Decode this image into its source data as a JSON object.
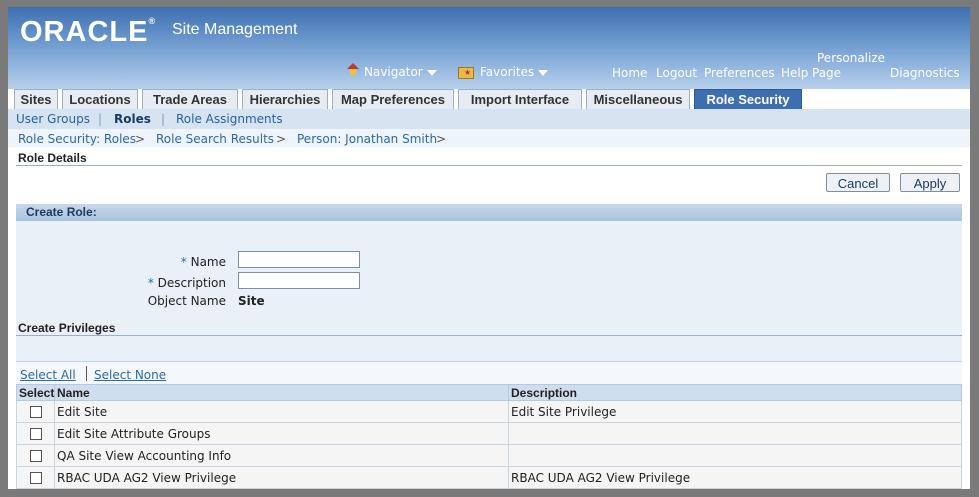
{
  "header": {
    "logo_text": "ORACLE",
    "logo_mark": "®",
    "app_title": "Site Management",
    "navigator_label": "Navigator",
    "favorites_label": "Favorites",
    "links": {
      "home": "Home",
      "logout": "Logout",
      "preferences": "Preferences",
      "help": "Help",
      "personalize_line1": "Personalize",
      "personalize_line2": "Page",
      "diagnostics": "Diagnostics"
    }
  },
  "tabs": [
    {
      "label": "Sites"
    },
    {
      "label": "Locations"
    },
    {
      "label": "Trade Areas"
    },
    {
      "label": "Hierarchies"
    },
    {
      "label": "Map Preferences"
    },
    {
      "label": "Import Interface"
    },
    {
      "label": "Miscellaneous"
    },
    {
      "label": "Role Security"
    }
  ],
  "subtabs": [
    {
      "label": "User Groups"
    },
    {
      "label": "Roles"
    },
    {
      "label": "Role Assignments"
    }
  ],
  "breadcrumb": [
    {
      "label": "Role Security: Roles"
    },
    {
      "label": "Role Search Results"
    },
    {
      "label": "Person: Jonathan Smith"
    }
  ],
  "breadcrumb_sep": ">",
  "page_title": "Role Details",
  "buttons": {
    "cancel": "Cancel",
    "apply": "Apply"
  },
  "create_role": {
    "header": "Create Role:",
    "required_mark": "*",
    "name_label": "Name",
    "name_value": "",
    "description_label": "Description",
    "description_value": "",
    "object_name_label": "Object Name",
    "object_name_value": "Site"
  },
  "privileges": {
    "header": "Create Privileges",
    "select_all": "Select All",
    "select_none": "Select None",
    "columns": {
      "select": "Select",
      "name": "Name",
      "description": "Description"
    },
    "rows": [
      {
        "name": "Edit Site",
        "description": "Edit Site Privilege",
        "checked": false
      },
      {
        "name": "Edit Site Attribute Groups",
        "description": "",
        "checked": false
      },
      {
        "name": "QA Site View Accounting Info",
        "description": "",
        "checked": false
      },
      {
        "name": "RBAC UDA AG2 View Privilege",
        "description": "RBAC UDA AG2 View Privilege",
        "checked": false
      }
    ]
  }
}
